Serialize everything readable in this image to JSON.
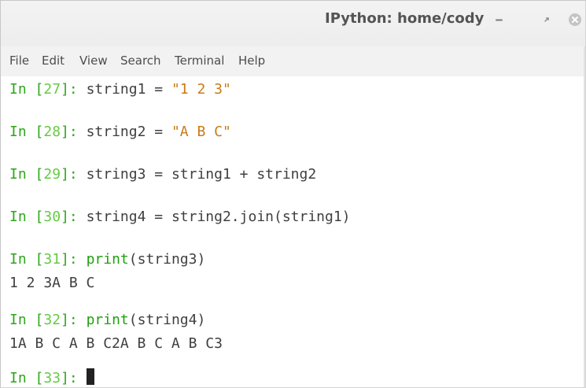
{
  "window": {
    "title": "IPython: home/cody",
    "controls": {
      "minimize_icon": "minimize-icon",
      "maximize_icon": "maximize-icon",
      "close_icon": "close-icon"
    }
  },
  "menu": {
    "items": [
      "File",
      "Edit",
      "View",
      "Search",
      "Terminal",
      "Help"
    ]
  },
  "terminal": {
    "lines": [
      {
        "prompt_word": "In",
        "number": "27",
        "code": "string1 = ",
        "code_string": "\"1 2 3\""
      },
      {
        "prompt_word": "In",
        "number": "28",
        "code": "string2 = ",
        "code_string": "\"A B C\""
      },
      {
        "prompt_word": "In",
        "number": "29",
        "code": "string3 = string1 + string2"
      },
      {
        "prompt_word": "In",
        "number": "30",
        "code": "string4 = string2.join(string1)"
      },
      {
        "prompt_word": "In",
        "number": "31",
        "builtin": "print",
        "args": "(string3)"
      },
      {
        "output": "1 2 3A B C"
      },
      {
        "prompt_word": "In",
        "number": "32",
        "builtin": "print",
        "args": "(string4)"
      },
      {
        "output": "1A B C A B C2A B C A B C3"
      },
      {
        "prompt_word": "In",
        "number": "33"
      }
    ]
  },
  "colors": {
    "prompt": "#2fa51b",
    "prompt_number": "#65cb43",
    "string_literal": "#c77b17",
    "builtin": "#1fa10f",
    "text": "#3f3f3f",
    "titlebar": "#efefef",
    "menubar": "#f2f2f2"
  }
}
